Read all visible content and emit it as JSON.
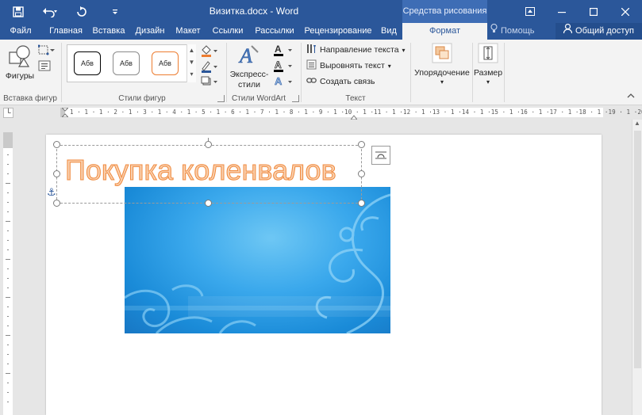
{
  "titlebar": {
    "save_icon": "save-icon",
    "undo_icon": "undo-icon",
    "redo_icon": "redo-icon",
    "customize_icon": "customize-qat-icon",
    "document_title": "Визитка.docx - Word",
    "context_title": "Средства рисования",
    "window_buttons": [
      "ribbon-display-icon",
      "minimize-icon",
      "maximize-icon",
      "close-icon"
    ]
  },
  "tabs": {
    "file": "Файл",
    "home": "Главная",
    "insert": "Вставка",
    "design": "Дизайн",
    "layout": "Макет",
    "references": "Ссылки",
    "mailings": "Рассылки",
    "review": "Рецензирование",
    "view": "Вид",
    "format": "Формат",
    "tell_me": "Помощь",
    "share": "Общий доступ"
  },
  "ribbon": {
    "insert_shapes": {
      "shapes_label": "Фигуры",
      "group_label": "Вставка фигур"
    },
    "shape_styles": {
      "swatch_text": "Абв",
      "swatch_colors": [
        "#000000",
        "#7f7f7f",
        "#ed7d31"
      ],
      "group_label": "Стили фигур"
    },
    "wordart": {
      "quick_styles_label_line1": "Экспресс-",
      "quick_styles_label_line2": "стили",
      "group_label": "Стили WordArt"
    },
    "text": {
      "text_direction": "Направление текста",
      "align_text": "Выровнять текст",
      "create_link": "Создать связь",
      "group_label": "Текст"
    },
    "arrange": {
      "label": "Упорядочение"
    },
    "size": {
      "label": "Размер"
    }
  },
  "ruler": {
    "corner_icon": "tab-stop-icon",
    "numbers": "1 · 1 · 1 · 2 · 1 · 3 · 1 · 4 · 1 · 5 · 1 · 6 · 1 · 7 · 1 · 8 · 1 · 9 · 1 ·10 · 1 ·11 · 1 ·12 · 1 ·13 · 1 ·14 · 1 ·15 · 1 ·16 · 1 ·17 · 1 ·18 · 1 ·19 · 1 ·20 ·"
  },
  "document": {
    "headline": "Покупка коленвалов",
    "text_color": "#f9cfad",
    "outline_color": "#f08a3e",
    "card_color": "#2a9be3"
  }
}
